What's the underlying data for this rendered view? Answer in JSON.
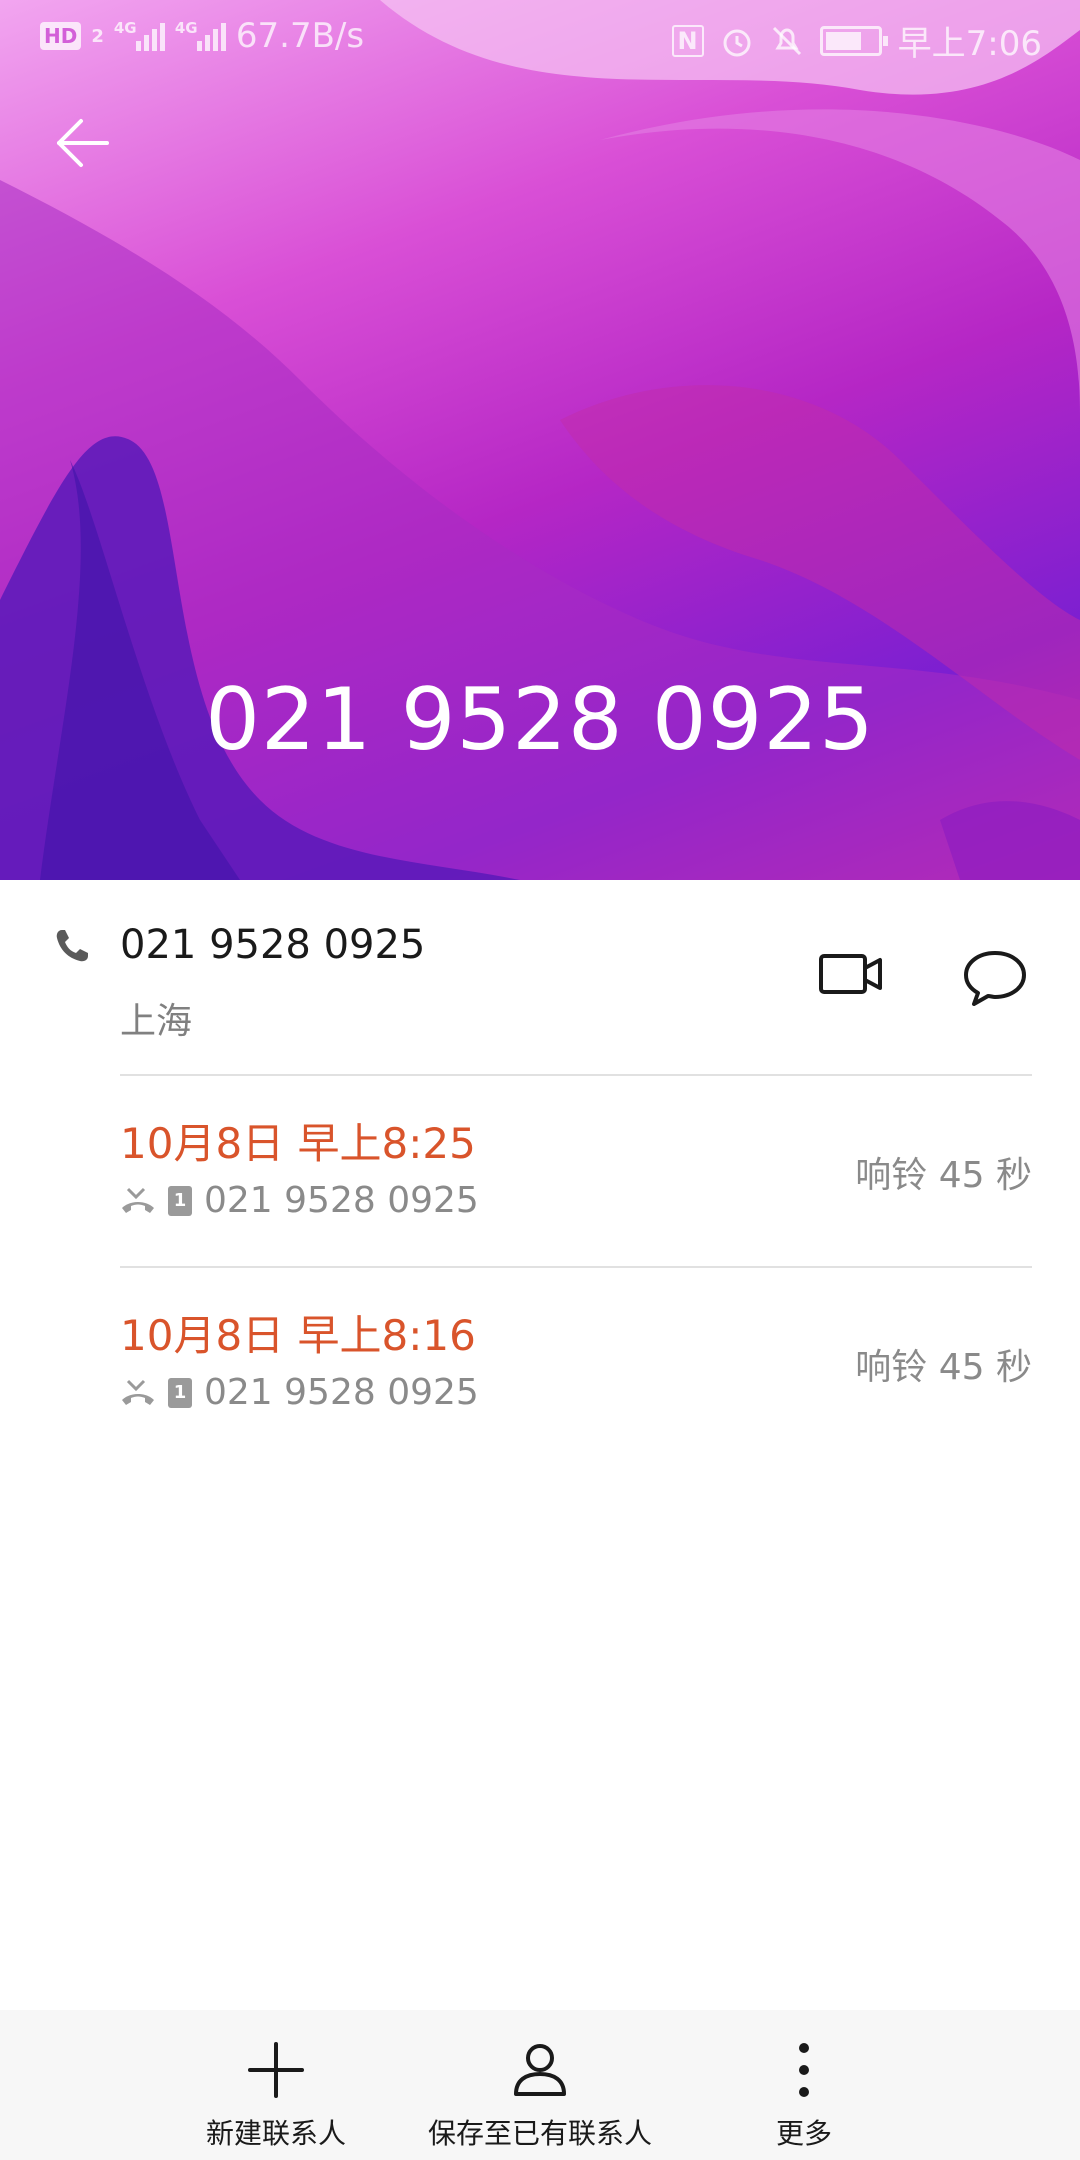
{
  "status_bar": {
    "hd": "HD",
    "sim": "2",
    "net1": "4G",
    "net2": "4G",
    "speed": "67.7B/s",
    "nfc": "N",
    "time": "早上7:06"
  },
  "header": {
    "number": "021 9528 0925"
  },
  "contact": {
    "number": "021 9528 0925",
    "location": "上海"
  },
  "calls": [
    {
      "time": "10月8日 早上8:25",
      "sim": "1",
      "number": "021 9528 0925",
      "duration": "响铃 45 秒"
    },
    {
      "time": "10月8日 早上8:16",
      "sim": "1",
      "number": "021 9528 0925",
      "duration": "响铃 45 秒"
    }
  ],
  "bottom_bar": {
    "new_contact": "新建联系人",
    "save_existing": "保存至已有联系人",
    "more": "更多"
  },
  "colors": {
    "accent_time": "#d9542b",
    "header_gradient_start": "#f2a6f0",
    "header_gradient_end": "#7c1fd1"
  }
}
